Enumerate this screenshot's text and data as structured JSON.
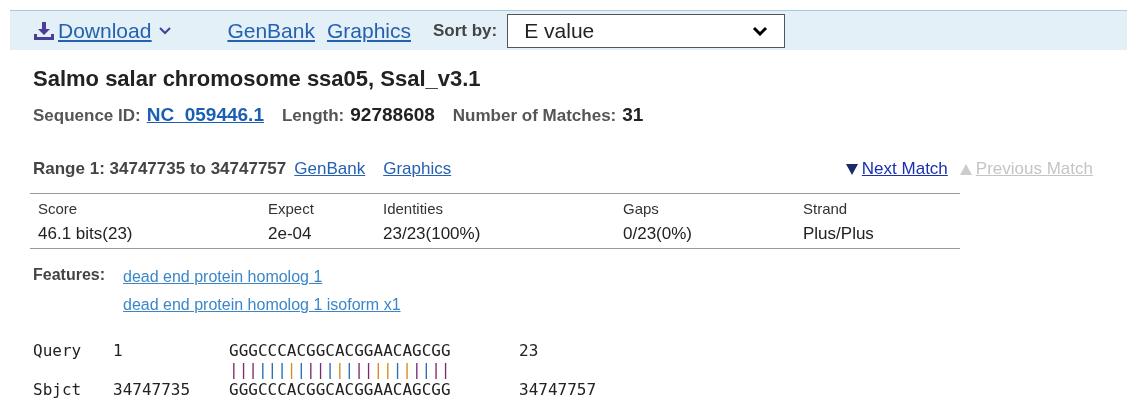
{
  "toolbar": {
    "download": "Download",
    "links": [
      "GenBank",
      "Graphics"
    ],
    "sort_label": "Sort by:",
    "sort_value": "E value"
  },
  "title": "Salmo salar chromosome ssa05, Ssal_v3.1",
  "meta": [
    {
      "label": "Sequence ID:",
      "value": "NC_059446.1",
      "kind": "link"
    },
    {
      "label": "Length:",
      "value": "92788608",
      "kind": "text"
    },
    {
      "label": "Number of Matches:",
      "value": "31",
      "kind": "text"
    }
  ],
  "range": {
    "label": "Range 1: 34747735 to 34747757",
    "links": [
      "GenBank",
      "Graphics"
    ],
    "next": {
      "label": "Next Match",
      "disabled": false
    },
    "previous": {
      "label": "Previous Match",
      "disabled": true
    }
  },
  "stats": {
    "columns": [
      "Score",
      "Expect",
      "Identities",
      "Gaps",
      "Strand"
    ],
    "values": [
      "46.1 bits(23)",
      "2e-04",
      "23/23(100%)",
      "0/23(0%)",
      "Plus/Plus"
    ]
  },
  "features": {
    "label": "Features:",
    "links": [
      "dead end protein homolog 1",
      "dead end protein homolog 1 isoform x1"
    ]
  },
  "alignment": {
    "query": {
      "label": "Query",
      "start": "1",
      "seq": "GGGCCCACGGCACGGAACAGCGG",
      "end": "23"
    },
    "match": "|||||||||||||||||||||||",
    "subject": {
      "label": "Sbjct",
      "start": "34747735",
      "seq": "GGGCCCACGGCACGGAACAGCGG",
      "end": "34747757"
    }
  }
}
